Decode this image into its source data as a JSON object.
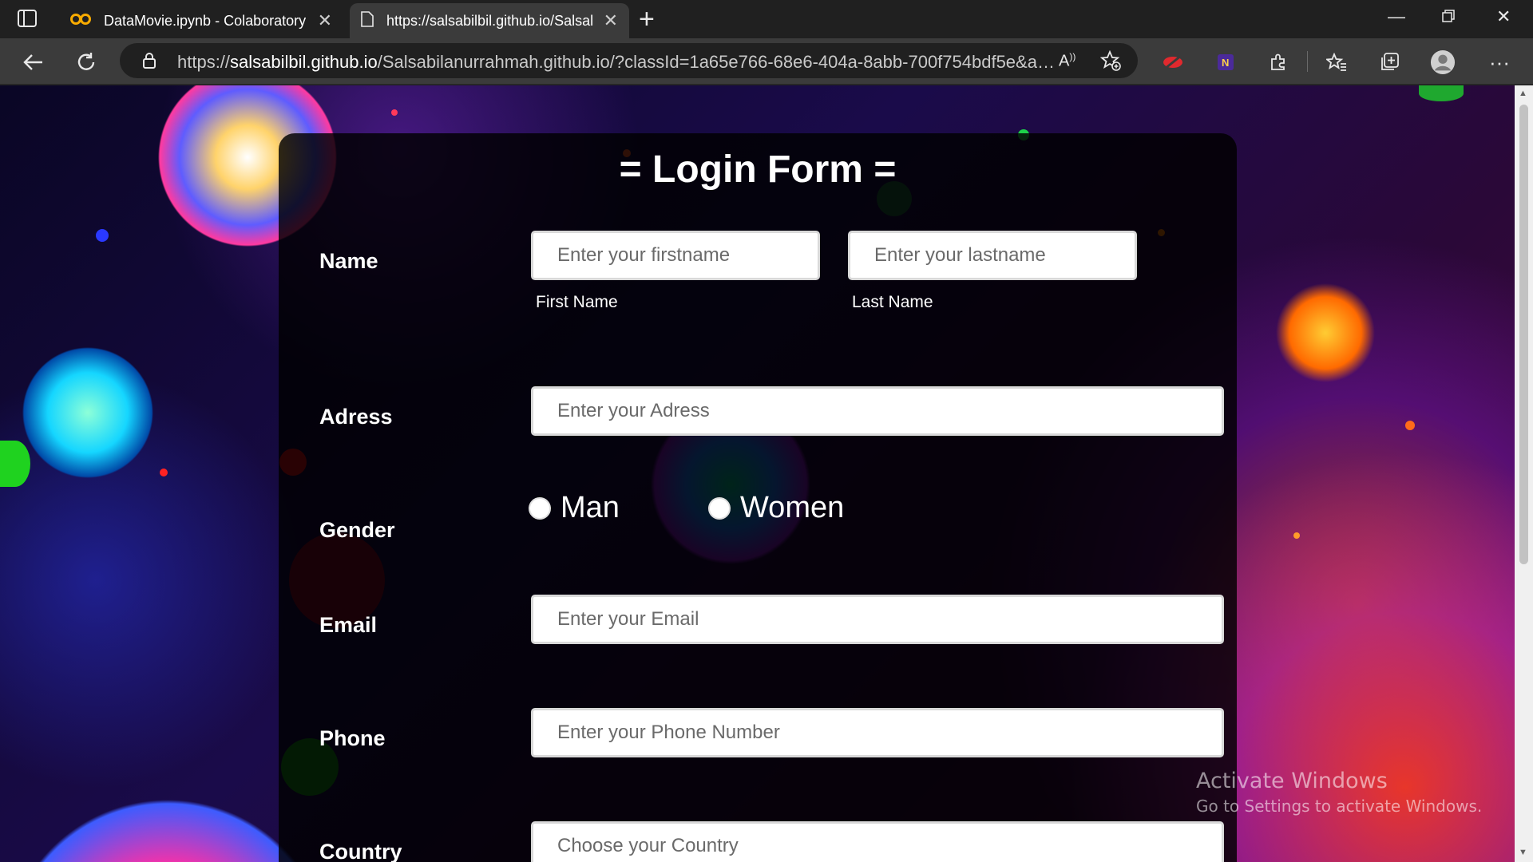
{
  "browser": {
    "tabs": [
      {
        "title": "DataMovie.ipynb - Colaboratory",
        "icon": "colab-icon",
        "active": false
      },
      {
        "title": "https://salsabilbil.github.io/Salsal",
        "icon": "page-icon",
        "active": true
      }
    ],
    "address": {
      "scheme": "https://",
      "host": "salsabilbil.github.io",
      "path": "/Salsabilanurrahmah.github.io/?classId=1a65e766-68e6-404a-8abb-700f754bdf5e&assig..."
    }
  },
  "form": {
    "title": "= Login Form =",
    "name_label": "Name",
    "firstname_placeholder": "Enter your firstname",
    "lastname_placeholder": "Enter your lastname",
    "first_name_sublabel": "First Name",
    "last_name_sublabel": "Last Name",
    "address_label": "Adress",
    "address_placeholder": "Enter your Adress",
    "gender_label": "Gender",
    "gender_options": [
      "Man",
      "Women"
    ],
    "email_label": "Email",
    "email_placeholder": "Enter your Email",
    "phone_label": "Phone",
    "phone_placeholder": "Enter your Phone Number",
    "country_label": "Country",
    "country_placeholder": "Choose your Country"
  },
  "watermark": {
    "line1": "Activate Windows",
    "line2": "Go to Settings to activate Windows."
  },
  "colors": {
    "chrome_dark": "#202020",
    "chrome_mid": "#3b3b3b",
    "panel": "#000000",
    "accent_red": "#e0292e"
  }
}
